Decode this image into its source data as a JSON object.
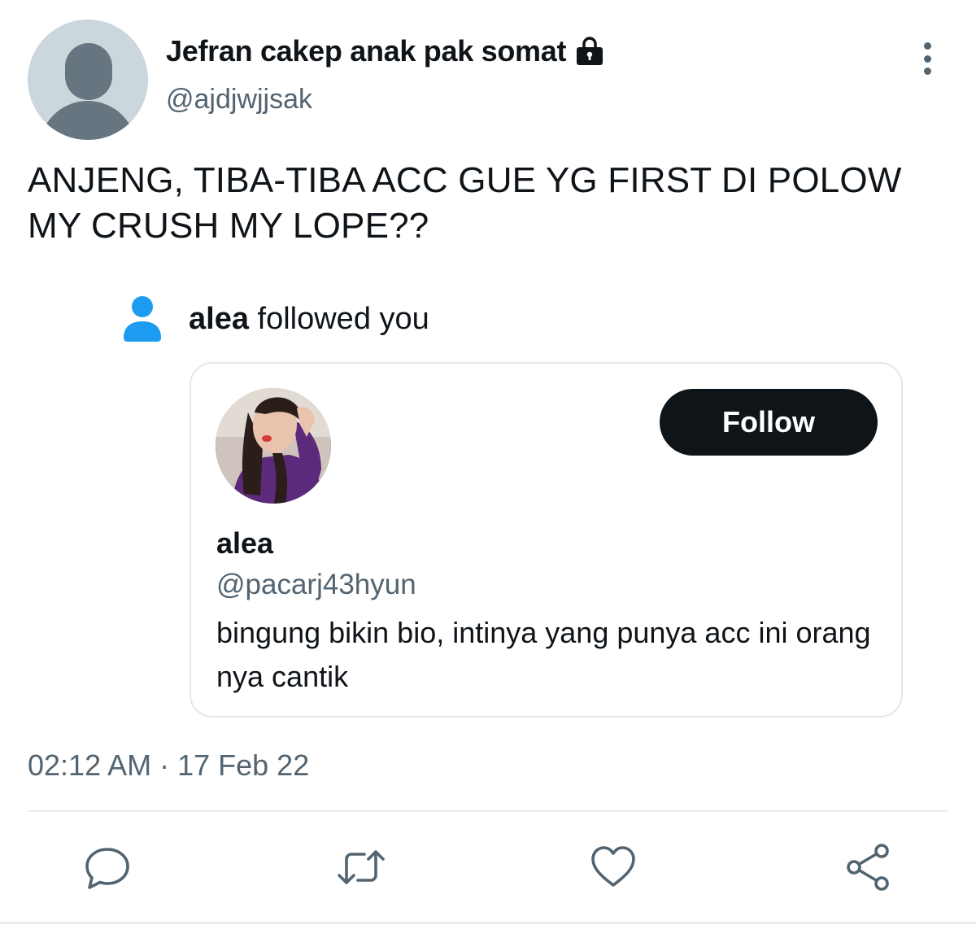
{
  "author": {
    "display_name": "Jefran cakep anak pak somat",
    "handle": "@ajdjwjjsak",
    "protected_icon": "lock-icon"
  },
  "tweet": {
    "text": "ANJENG, TIBA-TIBA ACC GUE YG FIRST DI POLOW MY CRUSH MY LOPE??",
    "timestamp": "02:12 AM · 17 Feb 22"
  },
  "notification": {
    "icon": "person-icon",
    "icon_color": "#1d9bf0",
    "user": "alea",
    "action_text": "followed you"
  },
  "profile_card": {
    "name": "alea",
    "handle": "@pacarj43hyun",
    "bio": "bingung bikin bio, intinya yang punya acc ini orang nya cantik",
    "follow_label": "Follow",
    "follow_button_color": "#0f1419"
  },
  "actions": [
    {
      "name": "reply",
      "icon": "reply-icon"
    },
    {
      "name": "retweet",
      "icon": "retweet-icon"
    },
    {
      "name": "like",
      "icon": "heart-icon"
    },
    {
      "name": "share",
      "icon": "share-icon"
    }
  ],
  "colors": {
    "secondary_text": "#536471",
    "border": "#e1e8ed"
  }
}
